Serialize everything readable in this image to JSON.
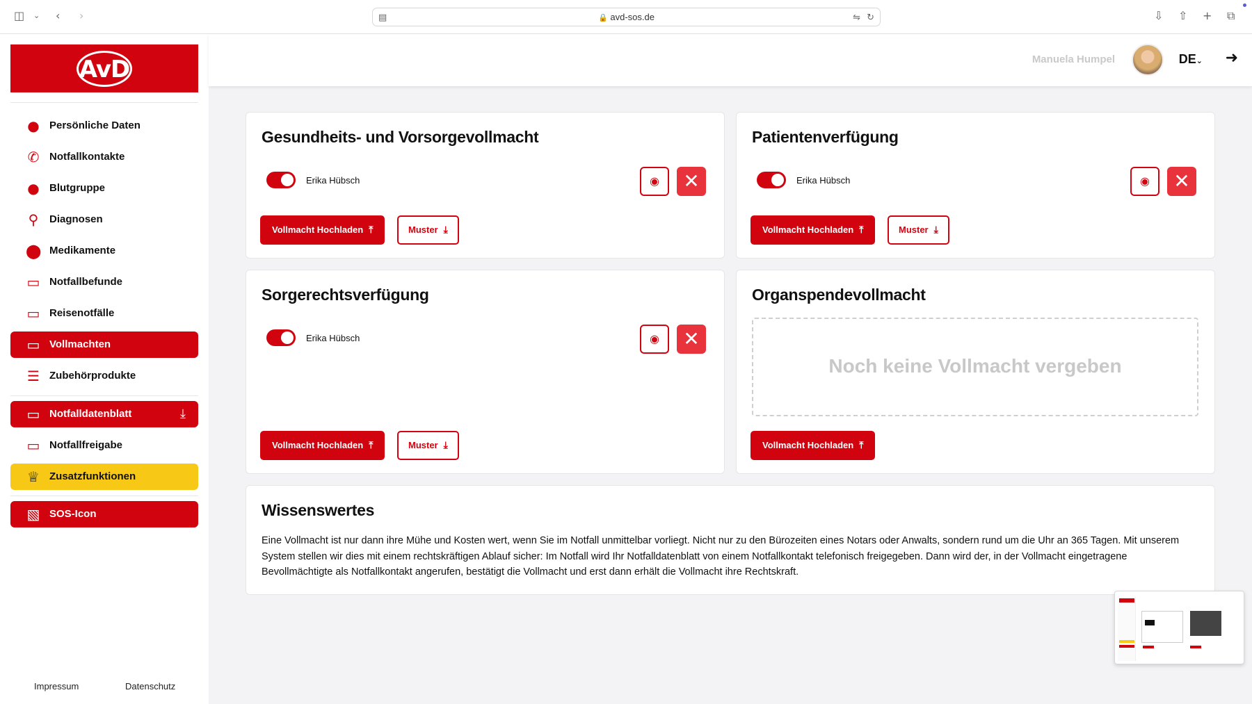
{
  "browser": {
    "url": "avd-sos.de",
    "icons": [
      "sidebar-toggle-icon",
      "chevron-down-icon",
      "back-icon",
      "forward-icon",
      "translate-icon",
      "reload-icon",
      "download-icon",
      "share-icon",
      "new-tab-icon",
      "tabs-icon"
    ]
  },
  "brand": {
    "logo_text": "AvD",
    "color": "#d0030f"
  },
  "sidebar": {
    "items": [
      {
        "label": "Persönliche Daten",
        "icon": "person-icon"
      },
      {
        "label": "Notfallkontakte",
        "icon": "phone-icon"
      },
      {
        "label": "Blutgruppe",
        "icon": "blood-drop-icon"
      },
      {
        "label": "Diagnosen",
        "icon": "search-icon"
      },
      {
        "label": "Medikamente",
        "icon": "pill-icon"
      },
      {
        "label": "Notfallbefunde",
        "icon": "document-icon"
      },
      {
        "label": "Reisenotfälle",
        "icon": "document-icon"
      },
      {
        "label": "Vollmachten",
        "icon": "document-icon",
        "active": true
      },
      {
        "label": "Zubehörprodukte",
        "icon": "list-icon"
      }
    ],
    "items2": [
      {
        "label": "Notfalldatenblatt",
        "icon": "document-icon",
        "right_icon": "download-icon"
      },
      {
        "label": "Notfallfreigabe",
        "icon": "document-icon"
      },
      {
        "label": "Zusatzfunktionen",
        "icon": "crown-icon",
        "color": "#f7c815"
      },
      {
        "label": "SOS-Icon",
        "icon": "pulse-icon"
      }
    ],
    "footer": {
      "impressum": "Impressum",
      "datenschutz": "Datenschutz"
    }
  },
  "header": {
    "user_name": "Manuela Humpel",
    "language": "DE"
  },
  "cards": {
    "c1": {
      "title": "Gesundheits- und Vorsorgevollmacht",
      "holder": "Erika Hübsch",
      "upload": "Vollmacht Hochladen",
      "muster": "Muster"
    },
    "c2": {
      "title": "Patientenverfügung",
      "holder": "Erika Hübsch",
      "upload": "Vollmacht Hochladen",
      "muster": "Muster"
    },
    "c3": {
      "title": "Sorgerechtsverfügung",
      "holder": "Erika Hübsch",
      "upload": "Vollmacht Hochladen",
      "muster": "Muster"
    },
    "c4": {
      "title": "Organspendevollmacht",
      "empty": "Noch keine Vollmacht vergeben",
      "upload": "Vollmacht Hochladen"
    }
  },
  "info": {
    "title": "Wissenswertes",
    "text": "Eine Vollmacht ist nur dann ihre Mühe und Kosten wert, wenn Sie im Notfall unmittelbar vorliegt. Nicht nur zu den Bürozeiten eines Notars oder Anwalts, sondern rund um die Uhr an 365 Tagen. Mit unserem System stellen wir dies mit einem rechtskräftigen Ablauf sicher: Im Notfall wird Ihr Notfalldatenblatt von einem Notfallkontakt telefonisch freigegeben. Dann wird der, in der Vollmacht eingetragene Bevollmächtigte als Notfallkontakt angerufen, bestätigt die Vollmacht und erst dann erhält die Vollmacht ihre Rechtskraft."
  }
}
